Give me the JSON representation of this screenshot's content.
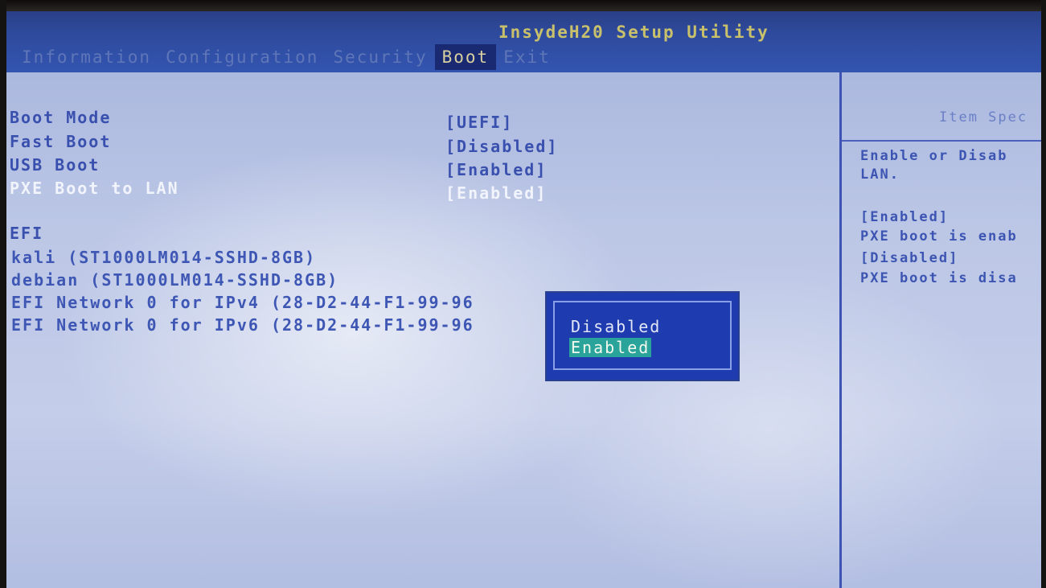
{
  "app": {
    "title": "InsydeH20 Setup Utility"
  },
  "menu": {
    "tabs": [
      {
        "label": "Information"
      },
      {
        "label": "Configuration"
      },
      {
        "label": "Security"
      },
      {
        "label": "Boot",
        "active": true
      },
      {
        "label": "Exit"
      }
    ]
  },
  "settings": [
    {
      "name": "Boot Mode",
      "value": "[UEFI]"
    },
    {
      "name": "Fast Boot",
      "value": "[Disabled]"
    },
    {
      "name": "USB Boot",
      "value": "[Enabled]"
    },
    {
      "name": "PXE Boot to LAN",
      "value": "[Enabled]",
      "selected": true
    }
  ],
  "boot_order": {
    "label": "EFI",
    "items": [
      "kali (ST1000LM014-SSHD-8GB)",
      "debian (ST1000LM014-SSHD-8GB)",
      "EFI Network 0 for IPv4 (28-D2-44-F1-99-96",
      "EFI Network 0 for IPv6 (28-D2-44-F1-99-96"
    ]
  },
  "help_panel": {
    "title": "Item Spec",
    "lines": [
      "Enable or Disab",
      "LAN.",
      "[Enabled]",
      "PXE boot is enab",
      "[Disabled]",
      "PXE boot is disa"
    ]
  },
  "popup": {
    "options": [
      "Disabled",
      "Enabled"
    ],
    "selected_option": "Enabled"
  },
  "colors": {
    "title_bar": "#2e4a9c",
    "active_tab_bg": "#1a2a72",
    "popup_bg": "#1f3bb0",
    "highlight": "#2aa39a"
  }
}
